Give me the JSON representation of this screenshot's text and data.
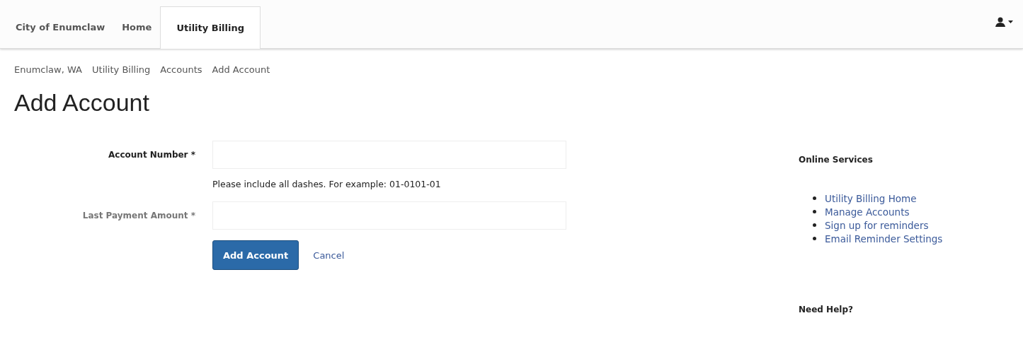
{
  "nav": {
    "brand": "City of Enumclaw",
    "tabs": [
      {
        "label": "Home",
        "selected": false
      },
      {
        "label": "Utility Billing",
        "selected": true
      }
    ]
  },
  "breadcrumb": [
    "Enumclaw, WA",
    "Utility Billing",
    "Accounts",
    "Add Account"
  ],
  "title": "Add Account",
  "form": {
    "fields": [
      {
        "label": "Account Number",
        "required_mark": "*",
        "help": "Please include all dashes. For example: 01-0101-01",
        "dimmed": false
      },
      {
        "label": "Last Payment Amount",
        "required_mark": "*",
        "dimmed": true
      }
    ],
    "submit": "Add Account",
    "cancel": "Cancel"
  },
  "sidebar": {
    "heading": "Online Services",
    "links": [
      "Utility Billing Home",
      "Manage Accounts",
      "Sign up for reminders",
      "Email Reminder Settings"
    ],
    "help_heading": "Need Help?"
  }
}
